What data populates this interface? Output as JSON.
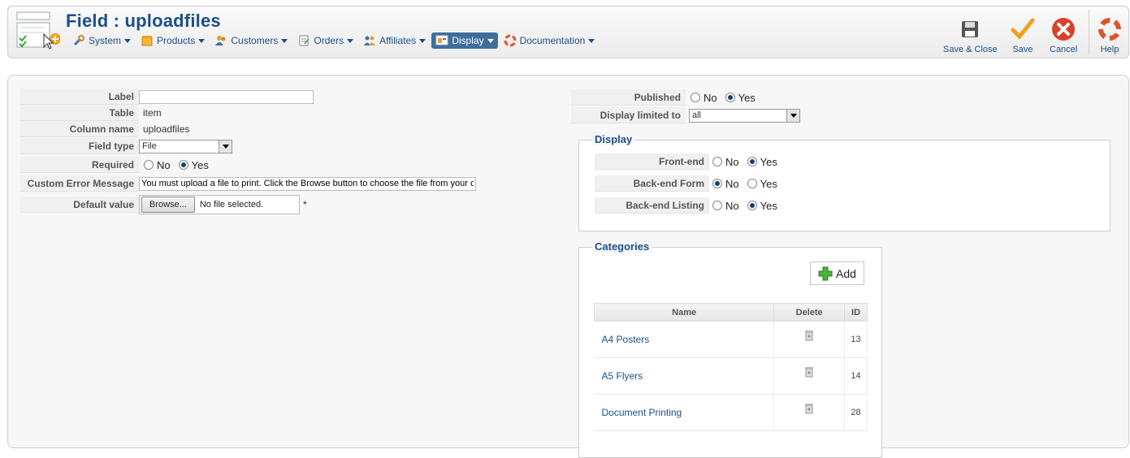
{
  "header": {
    "title": "Field : uploadfiles",
    "menu": [
      {
        "label": "System",
        "icon": "wrench-icon",
        "active": false
      },
      {
        "label": "Products",
        "icon": "box-icon",
        "active": false
      },
      {
        "label": "Customers",
        "icon": "users-icon",
        "active": false
      },
      {
        "label": "Orders",
        "icon": "orders-icon",
        "active": false
      },
      {
        "label": "Affiliates",
        "icon": "affiliates-icon",
        "active": false
      },
      {
        "label": "Display",
        "icon": "display-icon",
        "active": true
      },
      {
        "label": "Documentation",
        "icon": "lifebuoy-icon",
        "active": false
      }
    ],
    "toolbar": {
      "save_close": "Save & Close",
      "save": "Save",
      "cancel": "Cancel",
      "help": "Help"
    }
  },
  "form": {
    "label": {
      "label": "Label",
      "value": ""
    },
    "table": {
      "label": "Table",
      "value": "item"
    },
    "column_name": {
      "label": "Column name",
      "value": "uploadfiles"
    },
    "field_type": {
      "label": "Field type",
      "value": "File"
    },
    "required": {
      "label": "Required",
      "no": "No",
      "yes": "Yes",
      "selected": "Yes"
    },
    "custom_error": {
      "label": "Custom Error Message",
      "value": "You must upload a file to print. Click the Browse button to choose the file from your computer."
    },
    "default_value": {
      "label": "Default value",
      "browse": "Browse...",
      "status": "No file selected.",
      "marker": "*"
    }
  },
  "publish": {
    "published": {
      "label": "Published",
      "no": "No",
      "yes": "Yes",
      "selected": "Yes"
    },
    "display_limited": {
      "label": "Display limited to",
      "value": "all"
    }
  },
  "display": {
    "legend": "Display",
    "front_end": {
      "label": "Front-end",
      "no": "No",
      "yes": "Yes",
      "selected": "Yes"
    },
    "back_end_form": {
      "label": "Back-end Form",
      "no": "No",
      "yes": "Yes",
      "selected": "No"
    },
    "back_end_listing": {
      "label": "Back-end Listing",
      "no": "No",
      "yes": "Yes",
      "selected": "Yes"
    }
  },
  "categories": {
    "legend": "Categories",
    "add_label": "Add",
    "columns": {
      "name": "Name",
      "delete": "Delete",
      "id": "ID"
    },
    "rows": [
      {
        "name": "A4 Posters",
        "id": "13"
      },
      {
        "name": "A5 Flyers",
        "id": "14"
      },
      {
        "name": "Document Printing",
        "id": "28"
      }
    ]
  },
  "colors": {
    "accent": "#1b4f8a",
    "active_menu": "#3e6f9c",
    "cancel_red": "#d9412b",
    "save_orange": "#f2a01d"
  }
}
